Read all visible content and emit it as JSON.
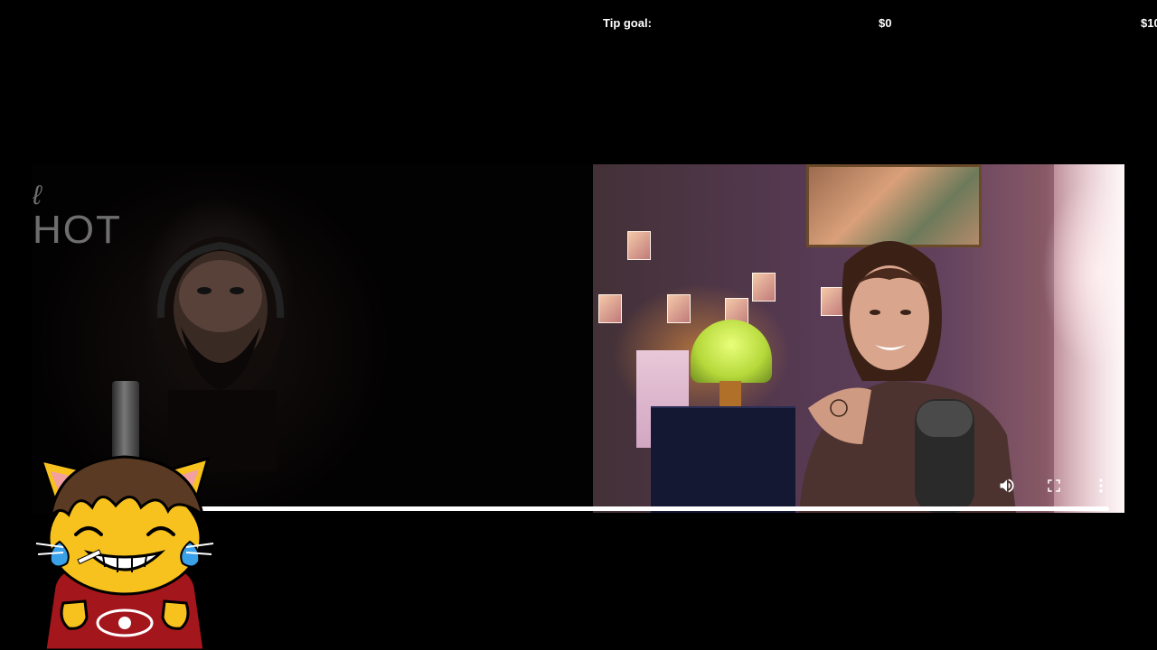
{
  "tip_goal": {
    "label": "Tip goal:",
    "current": "$0",
    "target": "$10"
  },
  "video": {
    "neon_sign_text": "HOT",
    "progress": 1.0,
    "controls": {
      "volume_icon": "volume-icon",
      "fullscreen_icon": "fullscreen-icon",
      "more_icon": "more-vertical-icon"
    }
  },
  "colors": {
    "background": "#000000",
    "text": "#ffffff",
    "progress": "#ffffff",
    "cat_yellow": "#f7c21d",
    "cat_hoodie": "#a3161c",
    "cat_hair": "#5a3a22"
  }
}
